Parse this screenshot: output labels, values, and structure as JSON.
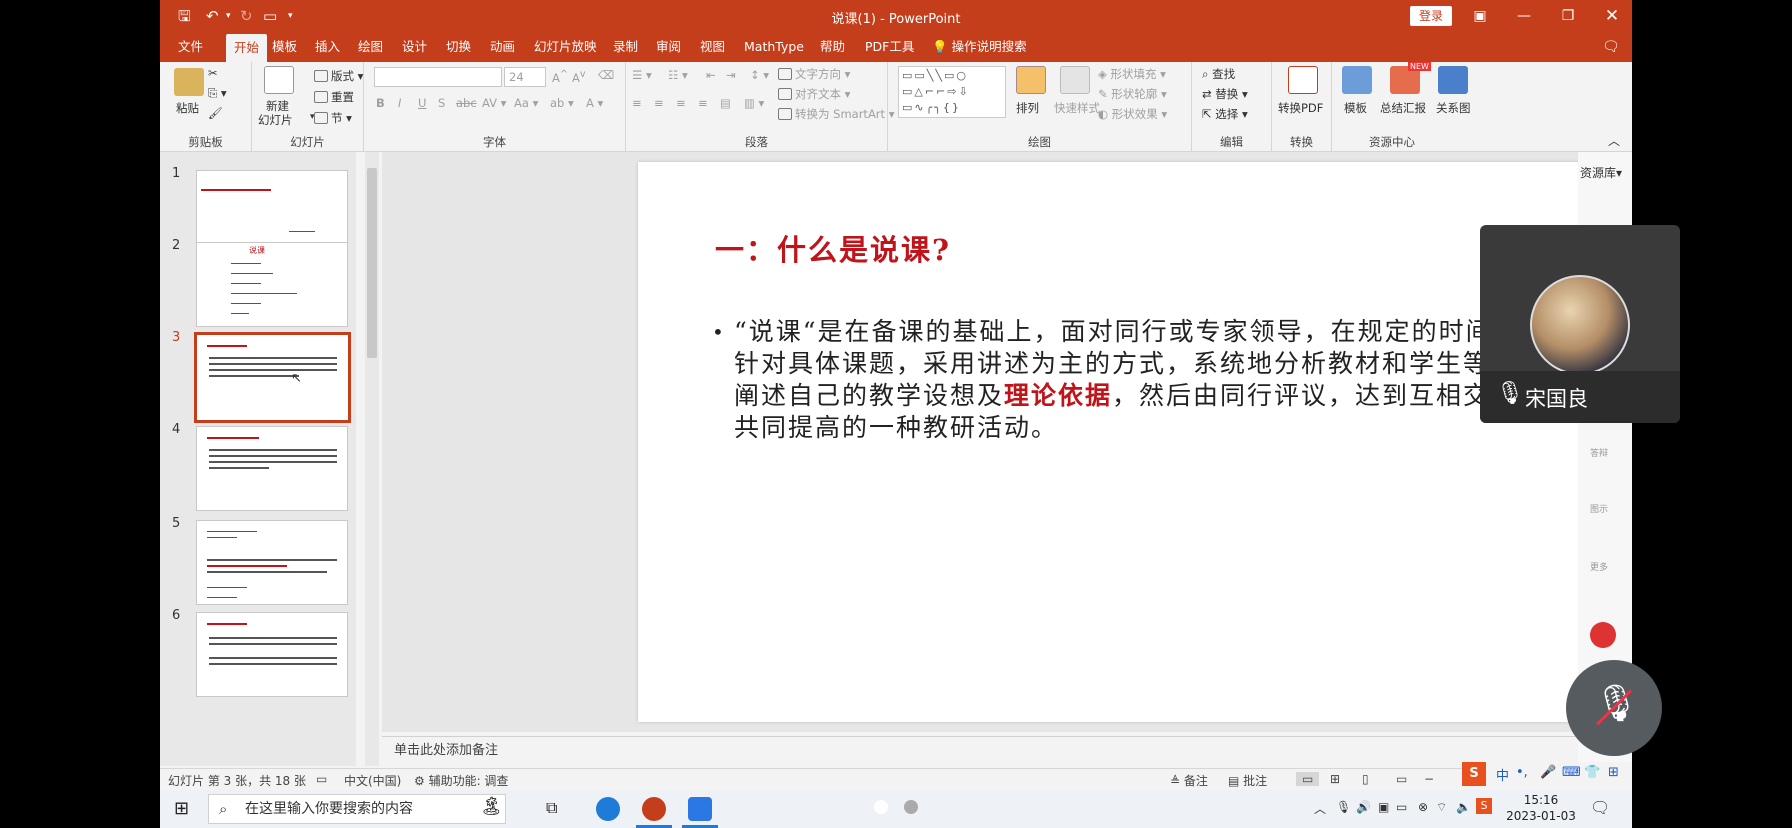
{
  "window": {
    "title": "说课(1)  -  PowerPoint",
    "login": "登录"
  },
  "tabs": [
    "文件",
    "开始",
    "模板",
    "插入",
    "绘图",
    "设计",
    "切换",
    "动画",
    "幻灯片放映",
    "录制",
    "审阅",
    "视图",
    "MathType",
    "帮助",
    "PDF工具"
  ],
  "tell_me": "操作说明搜索",
  "ribbon": {
    "clipboard": {
      "label": "剪贴板",
      "paste": "粘贴"
    },
    "slides": {
      "label": "幻灯片",
      "new_slide": "新建",
      "new_slide2": "幻灯片",
      "layout": "版式",
      "reset": "重置",
      "section": "节"
    },
    "font": {
      "label": "字体",
      "size": "24"
    },
    "paragraph": {
      "label": "段落",
      "text_dir": "文字方向",
      "align_text": "对齐文本",
      "smartart": "转换为 SmartArt"
    },
    "drawing": {
      "label": "绘图",
      "arrange": "排列",
      "quick_styles": "快速样式",
      "fill": "形状填充",
      "outline": "形状轮廓",
      "effects": "形状效果"
    },
    "editing": {
      "label": "编辑",
      "find": "查找",
      "replace": "替换",
      "select": "选择"
    },
    "convert": {
      "label": "转换",
      "to_pdf": "转换PDF"
    },
    "resources": {
      "label": "资源中心",
      "template": "模板",
      "summary": "总结汇报",
      "relation": "关系图",
      "new_badge": "NEW"
    }
  },
  "side_panel": {
    "title": "资源库",
    "items": [
      "答辩",
      "图示",
      "更多"
    ]
  },
  "thumbnails": {
    "numbers": [
      "1",
      "2",
      "3",
      "4",
      "5",
      "6"
    ],
    "selected": 3,
    "slide2_title": "说课"
  },
  "slide": {
    "title": "一：什么是说课?",
    "body_before": "“说课“是在备课的基础上，面对同行或专家领导，在规定的时间内，针对具体课题，采用讲述为主的方式，系统地分析教材和学生等，并阐述自己的教学设想及",
    "body_highlight": "理论依据",
    "body_after": "，然后由同行评议，达到互相交流，共同提高的一种教研活动。"
  },
  "notes_placeholder": "单击此处添加备注",
  "status": {
    "slide_info": "幻灯片 第 3 张，共 18 张",
    "language": "中文(中国)",
    "accessibility": "辅助功能: 调查",
    "notes": "备注",
    "comments": "批注"
  },
  "speaker": {
    "name": "宋国良"
  },
  "taskbar": {
    "search_placeholder": "在这里输入你要搜索的内容",
    "time": "15:16",
    "date": "2023-01-03",
    "ime": "中"
  },
  "colors": {
    "accent": "#c43e1c",
    "slide_red": "#c0141a"
  }
}
